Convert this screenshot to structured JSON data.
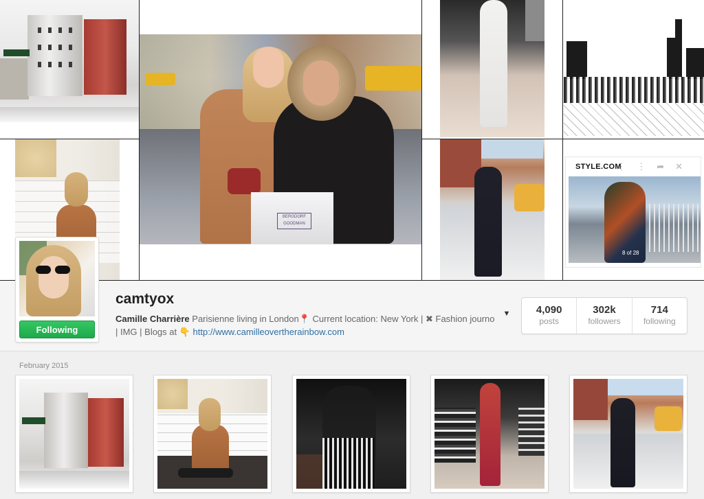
{
  "widget": {
    "brand": "STYLE.COM",
    "counter": "8 of 28"
  },
  "center_photo": {
    "bag_text": "BERGDORF GOODMAN"
  },
  "profile": {
    "username": "camtyox",
    "follow_label": "Following",
    "bio_name": "Camille Charrière",
    "bio_text_1": " Parisienne living in London",
    "bio_text_2": " Current location: New York | ",
    "bio_text_3": " Fashion journo | IMG | Blogs at ",
    "bio_link": "http://www.camilleovertherainbow.com",
    "pin_glyph": "📍",
    "cross_glyph": "✖",
    "hand_glyph": "👇",
    "dropdown_glyph": "▼"
  },
  "stats": [
    {
      "value": "4,090",
      "label": "posts"
    },
    {
      "value": "302k",
      "label": "followers"
    },
    {
      "value": "714",
      "label": "following"
    }
  ],
  "feed": {
    "month": "February 2015"
  },
  "colors": {
    "follow_green": "#2bb85a",
    "link_blue": "#2d6ea4"
  }
}
